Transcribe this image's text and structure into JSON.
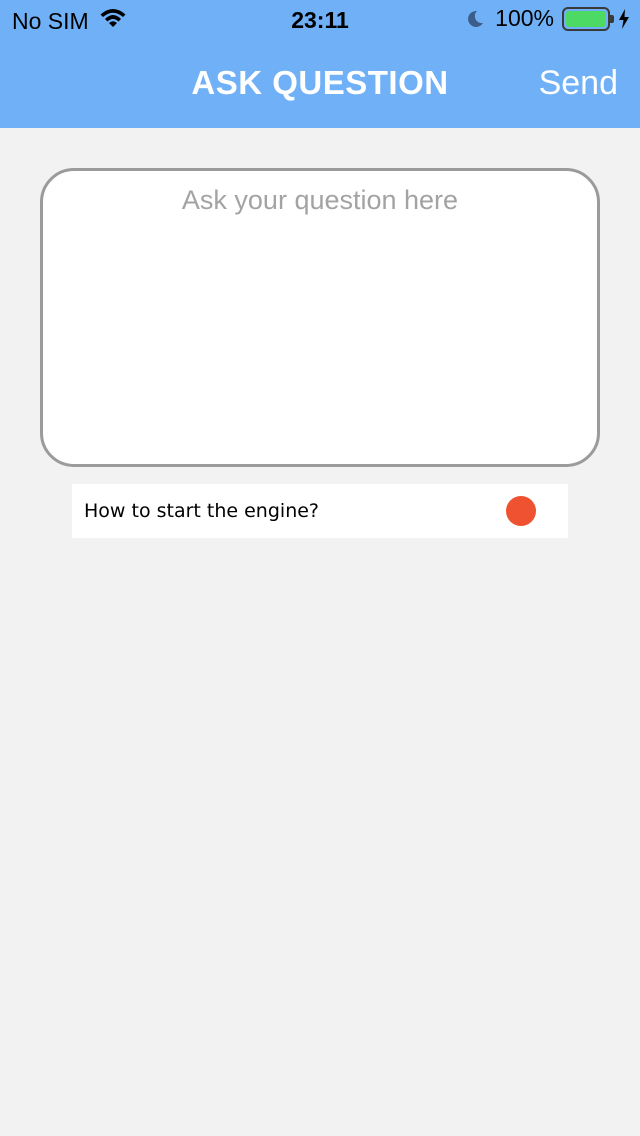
{
  "status_bar": {
    "carrier": "No SIM",
    "time": "23:11",
    "battery_percent": "100%",
    "icons": [
      "wifi-icon",
      "moon-icon",
      "battery-icon",
      "charging-bolt-icon"
    ]
  },
  "nav": {
    "title": "ASK QUESTION",
    "send_label": "Send",
    "background_color": "#6fb0f7"
  },
  "question": {
    "placeholder": "Ask your question here",
    "value": ""
  },
  "suggestions": [
    {
      "text": "How to start the engine?",
      "indicator_color": "#ef5230"
    }
  ]
}
